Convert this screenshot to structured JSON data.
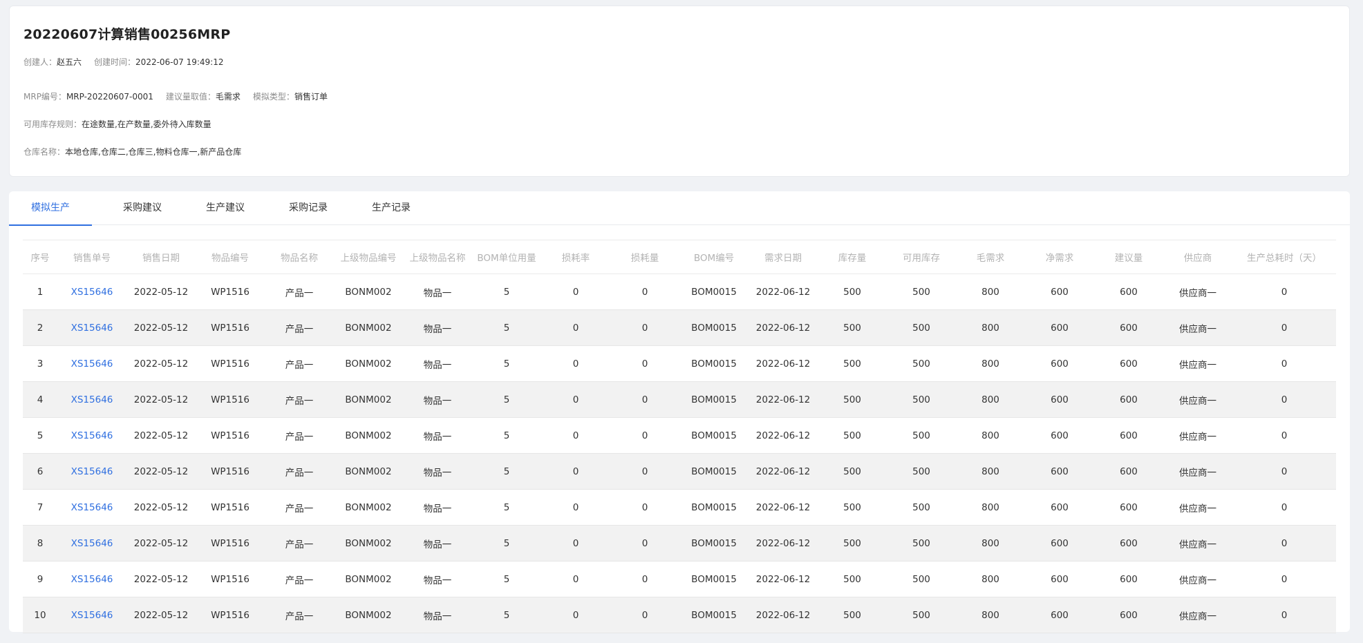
{
  "header": {
    "title": "20220607计算销售00256MRP",
    "creator_label": "创建人：",
    "creator": "赵五六",
    "created_label": "创建时间：",
    "created_time": "2022-06-07 19:49:12",
    "mrp_no_label": "MRP编号：",
    "mrp_no": "MRP-20220607-0001",
    "suggest_label": "建议量取值：",
    "suggest_value": "毛需求",
    "sim_type_label": "模拟类型：",
    "sim_type": "销售订单",
    "stock_rule_label": "可用库存规则：",
    "stock_rule": "在途数量,在产数量,委外待入库数量",
    "warehouse_label": "仓库名称：",
    "warehouse": "本地仓库,仓库二,仓库三,物料仓库一,新产品仓库"
  },
  "tabs": [
    "模拟生产",
    "采购建议",
    "生产建议",
    "采购记录",
    "生产记录"
  ],
  "active_tab": "模拟生产",
  "colors": {
    "accent": "#2f6fe0",
    "stripe": "#f2f2f2",
    "header_text": "#b3b3b3"
  },
  "table": {
    "columns": [
      "序号",
      "销售单号",
      "销售日期",
      "物品编号",
      "物品名称",
      "上级物品编号",
      "上级物品名称",
      "BOM单位用量",
      "损耗率",
      "损耗量",
      "BOM编号",
      "需求日期",
      "库存量",
      "可用库存",
      "毛需求",
      "净需求",
      "建议量",
      "供应商",
      "生产总耗时（天）"
    ],
    "rows": [
      [
        "1",
        "XS15646",
        "2022-05-12",
        "WP1516",
        "产品一",
        "BONM002",
        "物品一",
        "5",
        "0",
        "0",
        "BOM0015",
        "2022-06-12",
        "500",
        "500",
        "800",
        "600",
        "600",
        "供应商一",
        "0"
      ],
      [
        "2",
        "XS15646",
        "2022-05-12",
        "WP1516",
        "产品一",
        "BONM002",
        "物品一",
        "5",
        "0",
        "0",
        "BOM0015",
        "2022-06-12",
        "500",
        "500",
        "800",
        "600",
        "600",
        "供应商一",
        "0"
      ],
      [
        "3",
        "XS15646",
        "2022-05-12",
        "WP1516",
        "产品一",
        "BONM002",
        "物品一",
        "5",
        "0",
        "0",
        "BOM0015",
        "2022-06-12",
        "500",
        "500",
        "800",
        "600",
        "600",
        "供应商一",
        "0"
      ],
      [
        "4",
        "XS15646",
        "2022-05-12",
        "WP1516",
        "产品一",
        "BONM002",
        "物品一",
        "5",
        "0",
        "0",
        "BOM0015",
        "2022-06-12",
        "500",
        "500",
        "800",
        "600",
        "600",
        "供应商一",
        "0"
      ],
      [
        "5",
        "XS15646",
        "2022-05-12",
        "WP1516",
        "产品一",
        "BONM002",
        "物品一",
        "5",
        "0",
        "0",
        "BOM0015",
        "2022-06-12",
        "500",
        "500",
        "800",
        "600",
        "600",
        "供应商一",
        "0"
      ],
      [
        "6",
        "XS15646",
        "2022-05-12",
        "WP1516",
        "产品一",
        "BONM002",
        "物品一",
        "5",
        "0",
        "0",
        "BOM0015",
        "2022-06-12",
        "500",
        "500",
        "800",
        "600",
        "600",
        "供应商一",
        "0"
      ],
      [
        "7",
        "XS15646",
        "2022-05-12",
        "WP1516",
        "产品一",
        "BONM002",
        "物品一",
        "5",
        "0",
        "0",
        "BOM0015",
        "2022-06-12",
        "500",
        "500",
        "800",
        "600",
        "600",
        "供应商一",
        "0"
      ],
      [
        "8",
        "XS15646",
        "2022-05-12",
        "WP1516",
        "产品一",
        "BONM002",
        "物品一",
        "5",
        "0",
        "0",
        "BOM0015",
        "2022-06-12",
        "500",
        "500",
        "800",
        "600",
        "600",
        "供应商一",
        "0"
      ],
      [
        "9",
        "XS15646",
        "2022-05-12",
        "WP1516",
        "产品一",
        "BONM002",
        "物品一",
        "5",
        "0",
        "0",
        "BOM0015",
        "2022-06-12",
        "500",
        "500",
        "800",
        "600",
        "600",
        "供应商一",
        "0"
      ],
      [
        "10",
        "XS15646",
        "2022-05-12",
        "WP1516",
        "产品一",
        "BONM002",
        "物品一",
        "5",
        "0",
        "0",
        "BOM0015",
        "2022-06-12",
        "500",
        "500",
        "800",
        "600",
        "600",
        "供应商一",
        "0"
      ]
    ]
  }
}
